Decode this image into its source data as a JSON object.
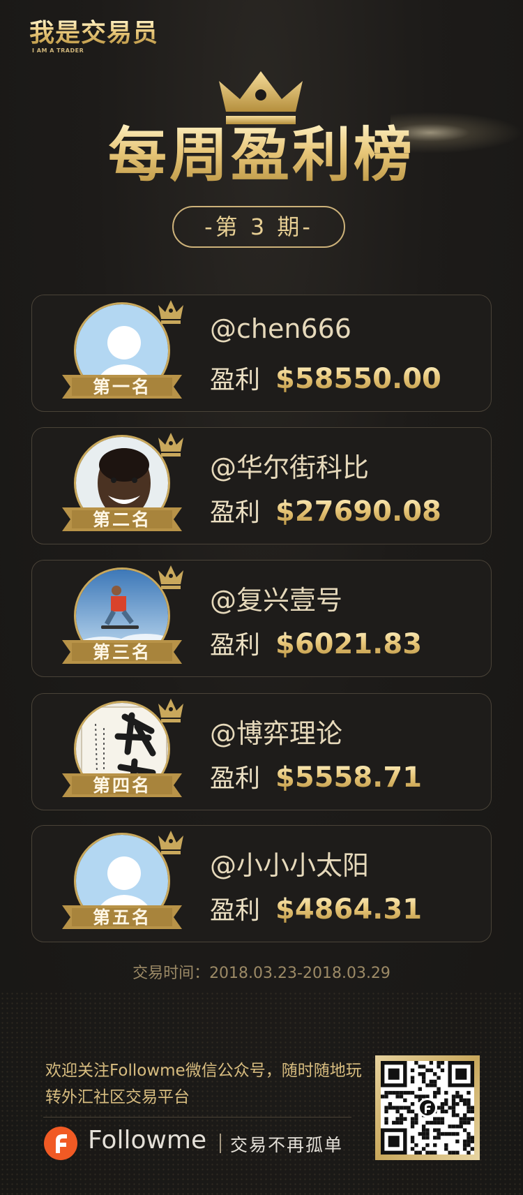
{
  "logo": {
    "main": "我是交易员",
    "sub": "I AM A TRADER"
  },
  "title": "每周盈利榜",
  "issue": "-第 3 期-",
  "profit_label": "盈利",
  "entries": [
    {
      "rank_label": "第一名",
      "username": "@chen666",
      "profit": "$58550.00",
      "avatar": "default-avatar"
    },
    {
      "rank_label": "第二名",
      "username": "@华尔街科比",
      "profit": "$27690.08",
      "avatar": "smiling-man-photo"
    },
    {
      "rank_label": "第三名",
      "username": "@复兴壹号",
      "profit": "$6021.83",
      "avatar": "skateboarder-photo"
    },
    {
      "rank_label": "第四名",
      "username": "@博弈理论",
      "profit": "$5558.71",
      "avatar": "calligraphy-photo"
    },
    {
      "rank_label": "第五名",
      "username": "@小小小太阳",
      "profit": "$4864.31",
      "avatar": "default-avatar"
    }
  ],
  "trade_time": "交易时间：2018.03.23-2018.03.29",
  "footer": {
    "welcome": "欢迎关注Followme微信公众号，随时随地玩转外汇社区交易平台",
    "brand": "Followme",
    "slogan": "交易不再孤单"
  },
  "colors": {
    "gold": "#c9a85c",
    "bg": "#1d1b19",
    "brand_orange": "#f15a24"
  }
}
